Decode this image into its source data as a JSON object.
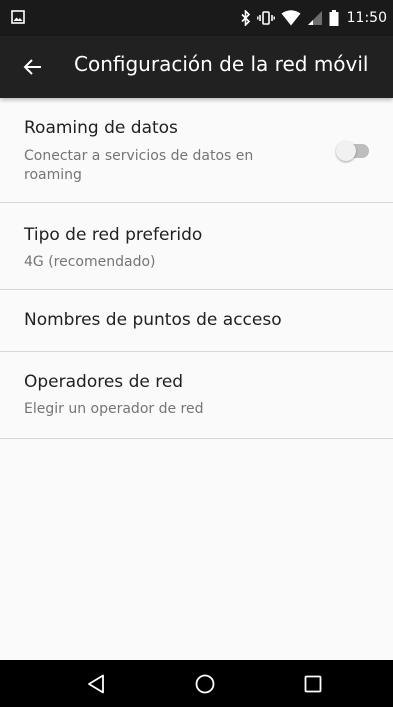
{
  "status_bar": {
    "time": "11:50"
  },
  "app_bar": {
    "title": "Configuración de la red móvil"
  },
  "settings": [
    {
      "title": "Roaming de datos",
      "summary": "Conectar a servicios de datos en roaming",
      "toggle_on": false
    },
    {
      "title": "Tipo de red preferido",
      "summary": "4G (recomendado)"
    },
    {
      "title": "Nombres de puntos de acceso"
    },
    {
      "title": "Operadores de red",
      "summary": "Elegir un operador de red"
    }
  ],
  "icons": {
    "status_left": "image-icon",
    "bluetooth": "bluetooth-icon",
    "vibrate": "vibrate-icon",
    "wifi": "wifi-icon",
    "signal": "cell-signal-icon",
    "battery": "battery-icon",
    "back": "arrow-back-icon",
    "nav_back": "triangle-back-icon",
    "nav_home": "circle-home-icon",
    "nav_recents": "square-recents-icon"
  },
  "colors": {
    "status_bar": "#1a1a1a",
    "app_bar": "#212121",
    "background": "#fafafa",
    "divider": "#d7d7d7",
    "toggle_track_off": "#bdbdbd",
    "nav_bar": "#000000"
  }
}
